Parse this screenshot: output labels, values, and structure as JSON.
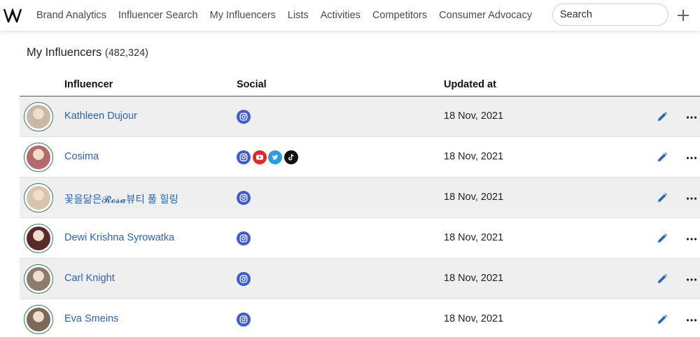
{
  "nav": {
    "items": [
      {
        "label": "Brand Analytics"
      },
      {
        "label": "Influencer Search"
      },
      {
        "label": "My Influencers"
      },
      {
        "label": "Lists"
      },
      {
        "label": "Activities"
      },
      {
        "label": "Competitors"
      },
      {
        "label": "Consumer Advocacy"
      }
    ],
    "search_placeholder": "Search",
    "add_icon": "plus-icon",
    "logo_icon": "w-logo-icon"
  },
  "page": {
    "title": "My Influencers",
    "count": "(482,324)"
  },
  "table": {
    "headers": {
      "influencer": "Influencer",
      "social": "Social",
      "updated": "Updated at"
    },
    "rows": [
      {
        "name": "Kathleen Dujour",
        "socials": [
          "instagram"
        ],
        "updated": "18 Nov, 2021"
      },
      {
        "name": "Cosima",
        "socials": [
          "instagram",
          "youtube",
          "twitter",
          "tiktok"
        ],
        "updated": "18 Nov, 2021"
      },
      {
        "name": "꽃을닮은𝓡𝓸𝓼𝓪뷰티 풀 힐링",
        "socials": [
          "instagram"
        ],
        "updated": "18 Nov, 2021"
      },
      {
        "name": "Dewi Krishna Syrowatka",
        "socials": [
          "instagram"
        ],
        "updated": "18 Nov, 2021"
      },
      {
        "name": "Carl Knight",
        "socials": [
          "instagram"
        ],
        "updated": "18 Nov, 2021"
      },
      {
        "name": "Eva Smeins",
        "socials": [
          "instagram"
        ],
        "updated": "18 Nov, 2021"
      }
    ]
  },
  "colors": {
    "link": "#2a63b8",
    "avatar_ring": "#2e7d4f",
    "instagram": "#3f5bd1",
    "youtube": "#e3262a",
    "twitter": "#2d9be6",
    "tiktok": "#111111",
    "edit_icon": "#2a63b8"
  }
}
